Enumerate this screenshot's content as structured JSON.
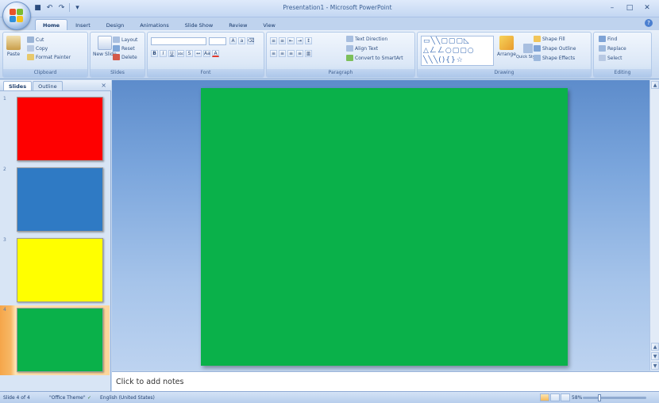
{
  "window": {
    "title": "Presentation1 - Microsoft PowerPoint"
  },
  "qat": {
    "save_glyph": "■",
    "undo_glyph": "↶",
    "redo_glyph": "↷",
    "more_glyph": "▾"
  },
  "controls": {
    "minimize": "–",
    "maximize": "□",
    "close": "✕"
  },
  "tabs": [
    "Home",
    "Insert",
    "Design",
    "Animations",
    "Slide Show",
    "Review",
    "View"
  ],
  "ribbon": {
    "clipboard": {
      "label": "Clipboard",
      "paste": "Paste",
      "cut": "Cut",
      "copy": "Copy",
      "format_painter": "Format Painter"
    },
    "slides": {
      "label": "Slides",
      "new_slide": "New Slide",
      "layout": "Layout",
      "reset": "Reset",
      "delete": "Delete"
    },
    "font": {
      "label": "Font",
      "bold": "B",
      "italic": "I",
      "underline": "U",
      "strike": "abc",
      "shadow": "S"
    },
    "paragraph": {
      "label": "Paragraph",
      "text_direction": "Text Direction",
      "align_text": "Align Text",
      "convert_smartart": "Convert to SmartArt"
    },
    "drawing": {
      "label": "Drawing",
      "arrange": "Arrange",
      "quick_styles": "Quick Styles",
      "shape_fill": "Shape Fill",
      "shape_outline": "Shape Outline",
      "shape_effects": "Shape Effects"
    },
    "editing": {
      "label": "Editing",
      "find": "Find",
      "replace": "Replace",
      "select": "Select"
    }
  },
  "panel": {
    "tabs": [
      "Slides",
      "Outline"
    ],
    "close": "×"
  },
  "slides": [
    {
      "number": "1",
      "color": "#fe0000"
    },
    {
      "number": "2",
      "color": "#2f7ac4"
    },
    {
      "number": "3",
      "color": "#ffff00"
    },
    {
      "number": "4",
      "color": "#0ab14a"
    }
  ],
  "current_slide": {
    "number": 4,
    "color": "#0ab14a"
  },
  "scrollbar": {
    "up": "▲",
    "down": "▼",
    "prev": "▲",
    "next": "▼"
  },
  "notes": {
    "placeholder": "Click to add notes"
  },
  "status": {
    "slide_info": "Slide 4 of 4",
    "theme": "\"Office Theme\"",
    "language": "English (United States)",
    "zoom": "58%"
  },
  "colors": {
    "accent": "#f5a64a",
    "ribbon": "#dce8f7"
  }
}
